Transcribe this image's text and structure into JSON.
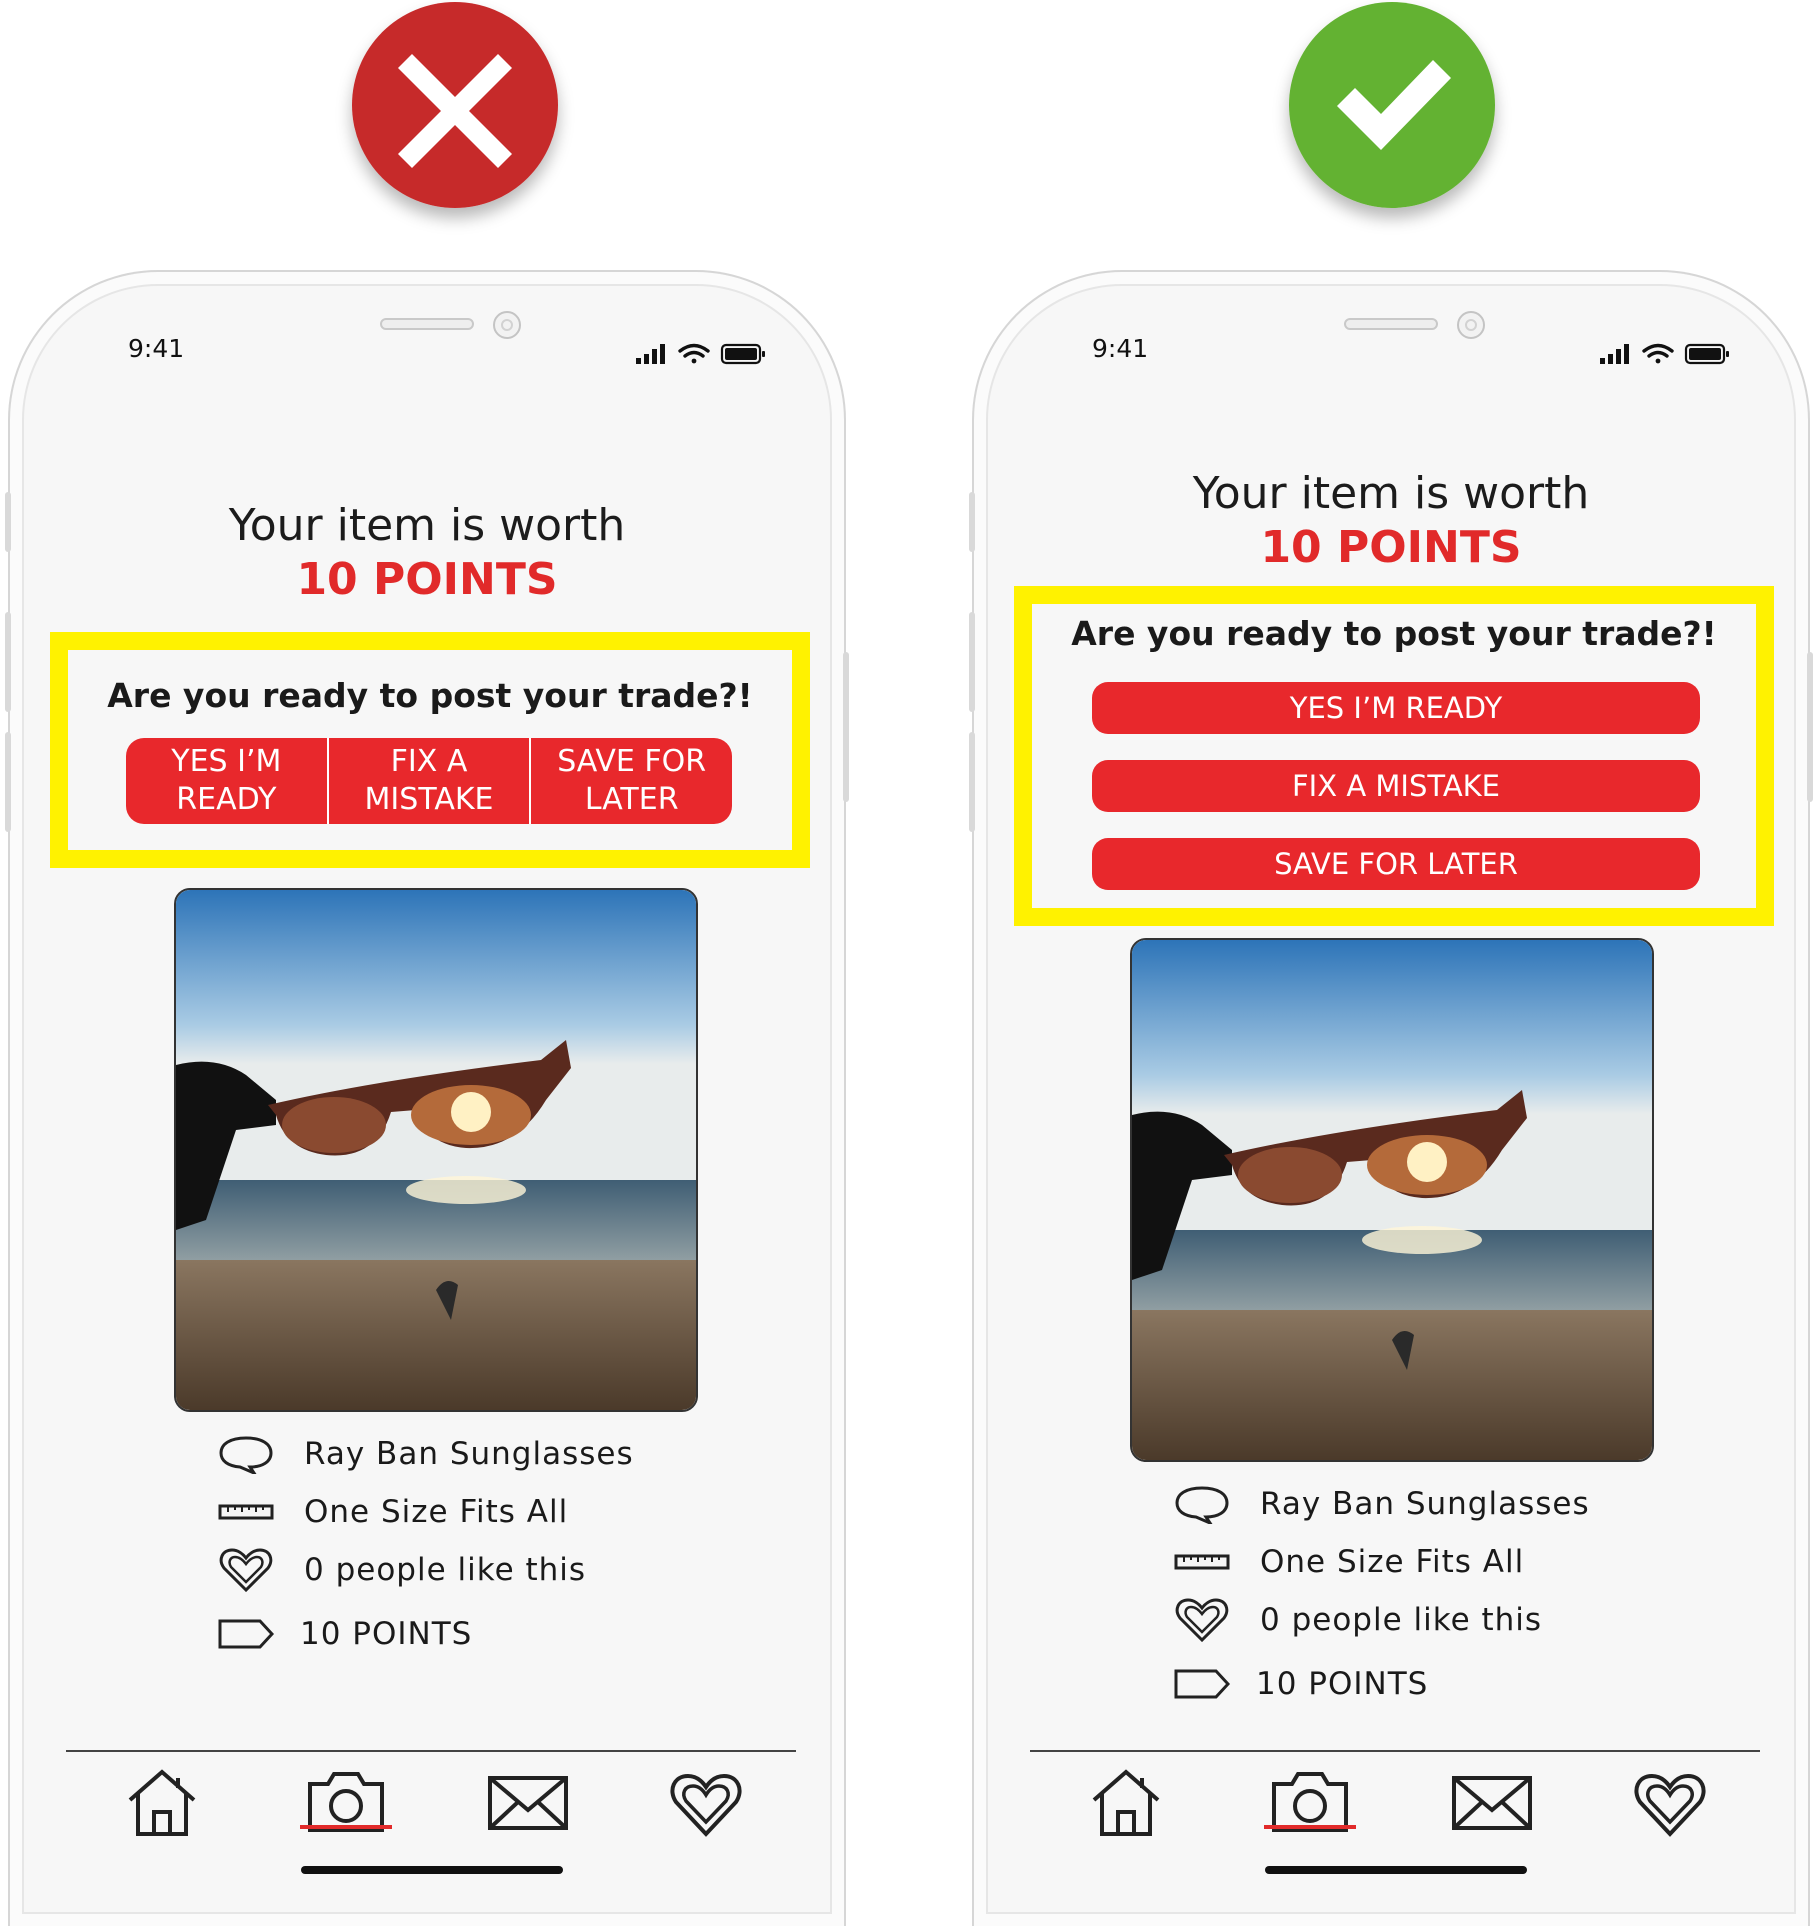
{
  "badges": {
    "left": {
      "icon": "cross-icon",
      "color": "#c62a2a"
    },
    "right": {
      "icon": "check-icon",
      "color": "#63b232"
    }
  },
  "phones": [
    {
      "status": {
        "time": "9:41"
      },
      "title": "Your item is worth",
      "points": "10 POINTS",
      "question": "Are you ready to post your trade?!",
      "buttons": [
        "YES I’M READY",
        "FIX A MISTAKE",
        "SAVE FOR LATER"
      ],
      "info": [
        {
          "icon": "speech-bubble-icon",
          "text": "Ray Ban Sunglasses"
        },
        {
          "icon": "ruler-icon",
          "text": "One Size Fits All"
        },
        {
          "icon": "heart-icon",
          "text": "0 people like this"
        },
        {
          "icon": "tag-icon",
          "text": "10 POINTS"
        }
      ]
    },
    {
      "status": {
        "time": "9:41"
      },
      "title": "Your item is worth",
      "points": "10 POINTS",
      "question": "Are you ready to post your trade?!",
      "buttons": [
        "YES I’M READY",
        "FIX A MISTAKE",
        "SAVE FOR LATER"
      ],
      "info": [
        {
          "icon": "speech-bubble-icon",
          "text": "Ray Ban Sunglasses"
        },
        {
          "icon": "ruler-icon",
          "text": "One Size Fits All"
        },
        {
          "icon": "heart-icon",
          "text": "0 people like this"
        },
        {
          "icon": "tag-icon",
          "text": "10 POINTS"
        }
      ]
    }
  ],
  "tabbar": [
    "home-icon",
    "camera-icon",
    "mail-icon",
    "heart-icon"
  ],
  "colors": {
    "accent": "#e8282c",
    "highlight": "#fff200"
  }
}
